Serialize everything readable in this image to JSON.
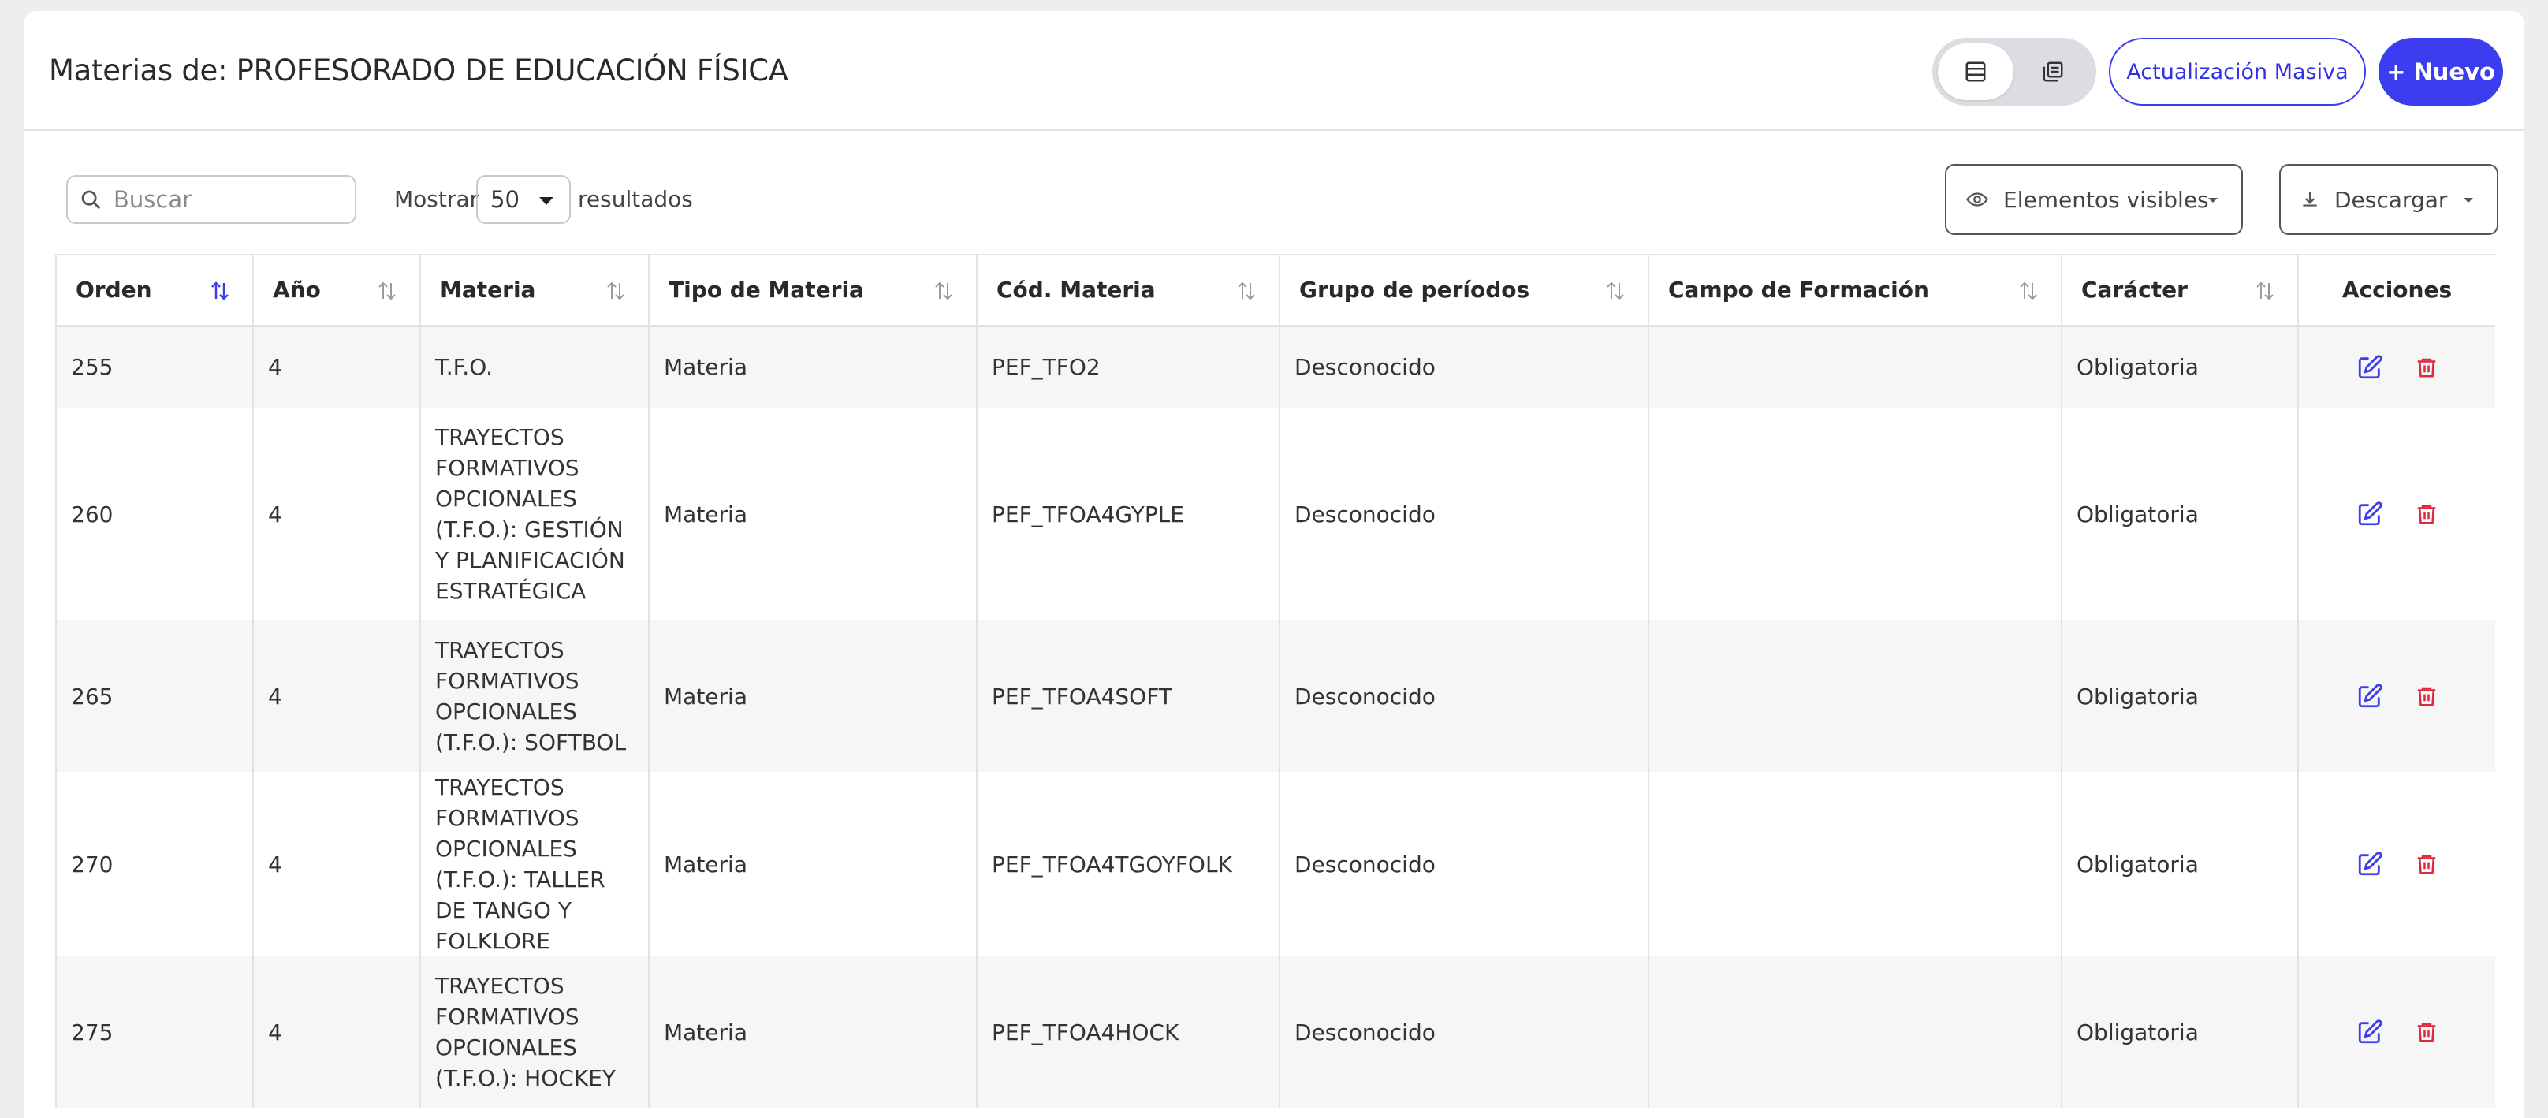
{
  "header": {
    "title": "Materias de: PROFESORADO DE EDUCACIÓN FÍSICA",
    "bulk_update_label": "Actualización Masiva",
    "new_label": "+ Nuevo"
  },
  "toolbar": {
    "search_placeholder": "Buscar",
    "show_label": "Mostrar",
    "show_value": "50",
    "results_label": "resultados",
    "visible_label": "Elementos visibles",
    "download_label": "Descargar"
  },
  "table": {
    "columns": [
      "Orden",
      "Año",
      "Materia",
      "Tipo de Materia",
      "Cód. Materia",
      "Grupo de períodos",
      "Campo de Formación",
      "Carácter",
      "Acciones"
    ],
    "rows": [
      {
        "orden": "255",
        "anio": "4",
        "materia": "T.F.O.",
        "tipo": "Materia",
        "codigo": "PEF_TFO2",
        "grupo": "Desconocido",
        "campo": "",
        "caracter": "Obligatoria"
      },
      {
        "orden": "260",
        "anio": "4",
        "materia": "TRAYECTOS FORMATIVOS OPCIONALES (T.F.O.): GESTIÓN Y PLANIFICACIÓN ESTRATÉGICA",
        "tipo": "Materia",
        "codigo": "PEF_TFOA4GYPLE",
        "grupo": "Desconocido",
        "campo": "",
        "caracter": "Obligatoria"
      },
      {
        "orden": "265",
        "anio": "4",
        "materia": "TRAYECTOS FORMATIVOS OPCIONALES (T.F.O.): SOFTBOL",
        "tipo": "Materia",
        "codigo": "PEF_TFOA4SOFT",
        "grupo": "Desconocido",
        "campo": "",
        "caracter": "Obligatoria"
      },
      {
        "orden": "270",
        "anio": "4",
        "materia": "TRAYECTOS FORMATIVOS OPCIONALES (T.F.O.): TALLER DE TANGO Y FOLKLORE",
        "tipo": "Materia",
        "codigo": "PEF_TFOA4TGOYFOLK",
        "grupo": "Desconocido",
        "campo": "",
        "caracter": "Obligatoria"
      },
      {
        "orden": "275",
        "anio": "4",
        "materia": "TRAYECTOS FORMATIVOS OPCIONALES (T.F.O.): HOCKEY",
        "tipo": "Materia",
        "codigo": "PEF_TFOA4HOCK",
        "grupo": "Desconocido",
        "campo": "",
        "caracter": "Obligatoria"
      }
    ]
  },
  "colors": {
    "accent": "#3d3df0",
    "delete": "#e0283c",
    "sort_active": "#3d3df0",
    "sort_inactive": "#9a9aa0"
  }
}
